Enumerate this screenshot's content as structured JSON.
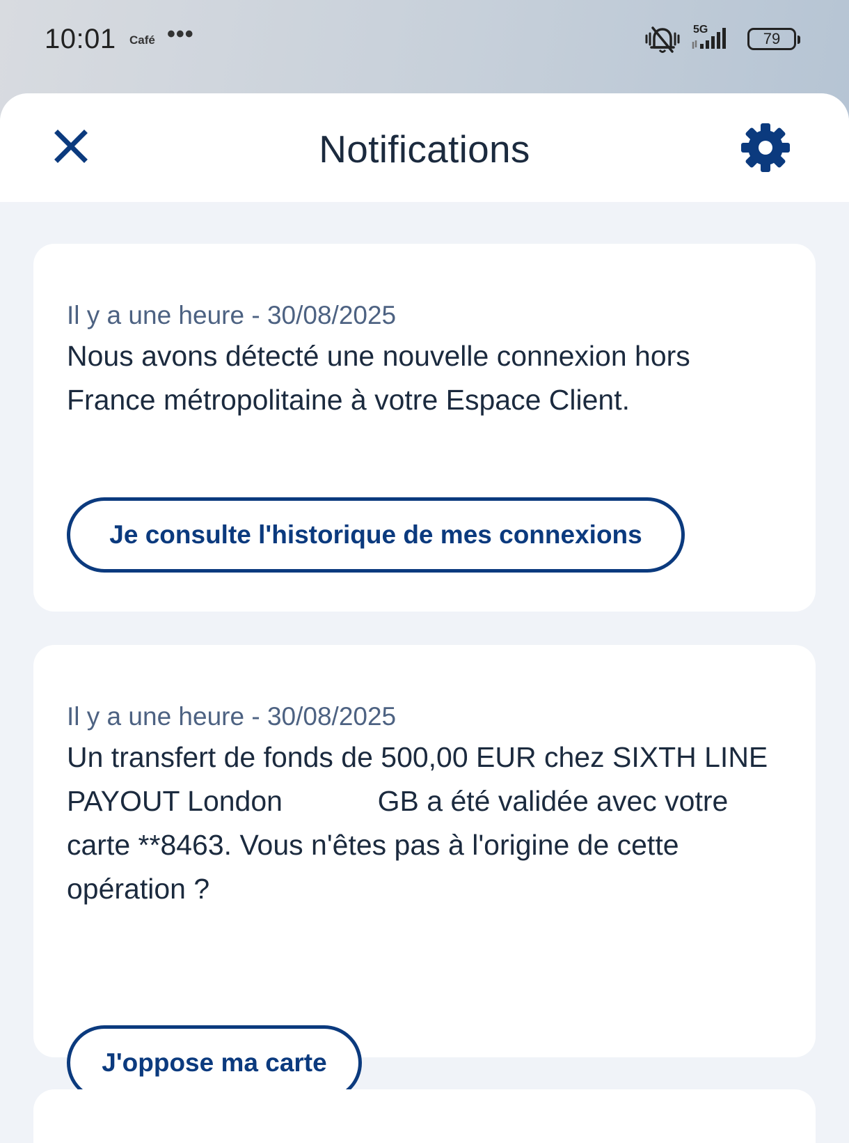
{
  "status_bar": {
    "time": "10:01",
    "carrier_label": "Café",
    "more_indicator": "•••",
    "network": "5G",
    "battery": "79",
    "icons": [
      "silent-bell-icon",
      "signal-icon",
      "battery-icon"
    ]
  },
  "header": {
    "title": "Notifications",
    "close_icon": "close-icon",
    "settings_icon": "gear-icon"
  },
  "notifications": [
    {
      "date": "Il y a une heure - 30/08/2025",
      "message": "Nous avons détecté une nouvelle connexion hors France métropolitaine à votre Espace Client.",
      "action_label": "Je consulte l'historique de mes connexions"
    },
    {
      "date": "Il y a une heure - 30/08/2025",
      "message": "Un transfert de fonds de 500,00 EUR chez SIXTH LINE PAYOUT London            GB a été validée avec votre carte **8463. Vous n'êtes pas à l'origine de cette opération ?",
      "action_label": "J'oppose ma carte"
    }
  ],
  "colors": {
    "accent": "#0b3a7e",
    "title_text": "#1b2a3e",
    "date_text": "#4d6282",
    "sheet_background": "#f0f3f8",
    "card_background": "#ffffff"
  }
}
